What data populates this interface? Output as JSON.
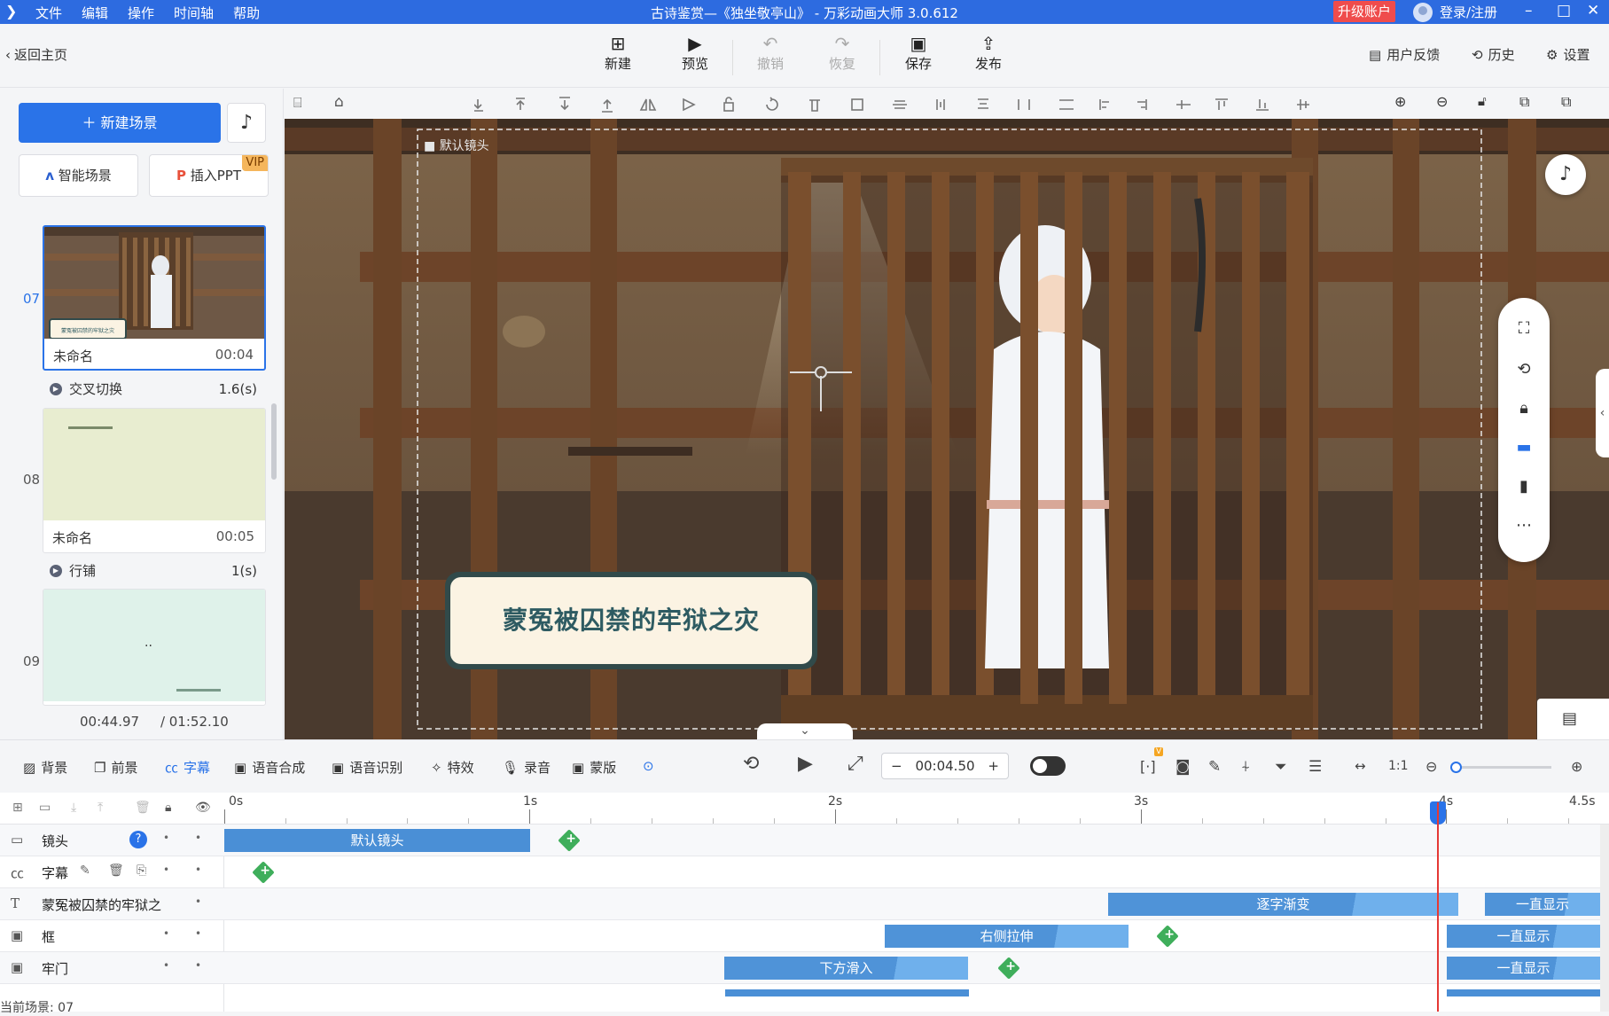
{
  "titlebar": {
    "menus": [
      "文件",
      "编辑",
      "操作",
      "时间轴",
      "帮助"
    ],
    "title": "古诗鉴赏—《独坐敬亭山》 - 万彩动画大师 3.0.612",
    "upgrade": "升级账户",
    "login": "登录/注册"
  },
  "toolbar": {
    "back": "返回主页",
    "buttons": [
      {
        "label": "新建",
        "icon": "new-icon"
      },
      {
        "label": "预览",
        "icon": "play-icon"
      },
      {
        "label": "撤销",
        "icon": "undo-icon"
      },
      {
        "label": "恢复",
        "icon": "redo-icon"
      },
      {
        "label": "保存",
        "icon": "save-icon"
      },
      {
        "label": "发布",
        "icon": "publish-icon"
      }
    ],
    "feedback": "用户反馈",
    "history": "历史",
    "settings": "设置"
  },
  "leftpanel": {
    "new_scene": "新建场景",
    "smart_scene": "智能场景",
    "insert_ppt": "插入PPT",
    "vip": "VIP",
    "scenes": [
      {
        "num": "07",
        "name": "未命名",
        "duration": "00:04",
        "active": true,
        "thumb_caption": "蒙冤被囚禁的牢狱之灾"
      },
      {
        "num": "08",
        "name": "未命名",
        "duration": "00:05",
        "active": false
      },
      {
        "num": "09",
        "name": "",
        "duration": "",
        "active": false
      }
    ],
    "transitions": [
      {
        "name": "交叉切换",
        "value": "1.6(s)"
      },
      {
        "name": "行铺",
        "value": "1(s)"
      }
    ],
    "current_time": "00:44.97",
    "total_time": "/ 01:52.10"
  },
  "canvas": {
    "camera_label": "默认镜头",
    "subtitle": "蒙冤被囚禁的牢狱之灾"
  },
  "timeline_bar": {
    "items": [
      "背景",
      "前景",
      "字幕",
      "语音合成",
      "语音识别",
      "特效",
      "录音",
      "蒙版"
    ],
    "active_item": "字幕",
    "time": "00:04.50"
  },
  "ruler": {
    "ticks": [
      "0s",
      "1s",
      "2s",
      "3s",
      "4s",
      "4.5s"
    ]
  },
  "tracks": [
    {
      "name": "镜头",
      "icon": "camera-icon",
      "segments": [
        {
          "label": "默认镜头"
        }
      ]
    },
    {
      "name": "字幕",
      "icon": "cc-icon",
      "segments": []
    },
    {
      "name": "蒙冤被囚禁的牢狱之",
      "icon": "text-icon",
      "segments": [
        {
          "label": "逐字渐变"
        },
        {
          "label": "一直显示"
        }
      ]
    },
    {
      "name": "框",
      "icon": "image-icon",
      "segments": [
        {
          "label": "右侧拉伸"
        },
        {
          "label": "一直显示"
        }
      ]
    },
    {
      "name": "牢门",
      "icon": "image-icon",
      "segments": [
        {
          "label": "下方滑入"
        },
        {
          "label": "一直显示"
        }
      ]
    }
  ],
  "status": "当前场景: 07"
}
